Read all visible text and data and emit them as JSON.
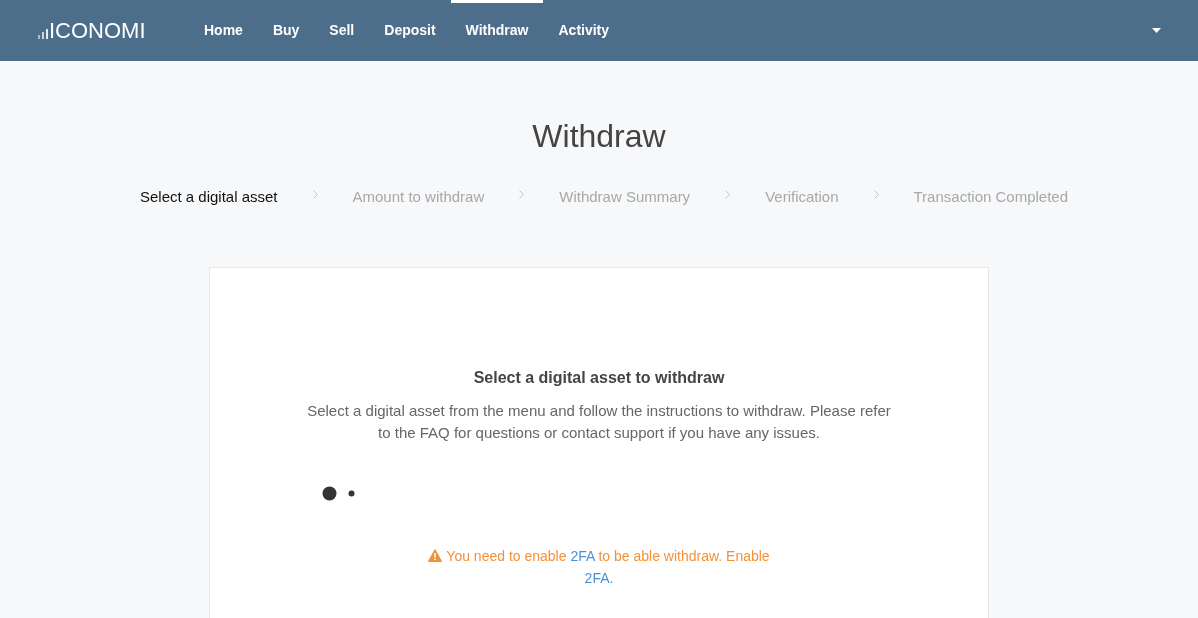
{
  "nav": {
    "logo": "ICONOMI",
    "items": [
      {
        "label": "Home",
        "selected": false
      },
      {
        "label": "Buy",
        "selected": false
      },
      {
        "label": "Sell",
        "selected": false
      },
      {
        "label": "Deposit",
        "selected": false
      },
      {
        "label": "Withdraw",
        "selected": true
      },
      {
        "label": "Activity",
        "selected": false
      }
    ]
  },
  "page_title": "Withdraw",
  "steps": [
    {
      "label": "Select a digital asset",
      "selected": true
    },
    {
      "label": "Amount to withdraw",
      "selected": false
    },
    {
      "label": "Withdraw Summary",
      "selected": false
    },
    {
      "label": "Verification",
      "selected": false
    },
    {
      "label": "Transaction Completed",
      "selected": false
    }
  ],
  "card": {
    "heading": "Select a digital asset to withdraw",
    "description": "Select a digital asset from the menu and follow the instructions to withdraw. Please refer to the FAQ for questions or contact support if you have any issues.",
    "warning": [
      {
        "kind": "text",
        "text": "You need to enable "
      },
      {
        "kind": "link",
        "text": "2FA"
      },
      {
        "kind": "text",
        "text": " to be able withdraw. Enable "
      },
      {
        "kind": "link",
        "text": "2FA."
      }
    ]
  }
}
